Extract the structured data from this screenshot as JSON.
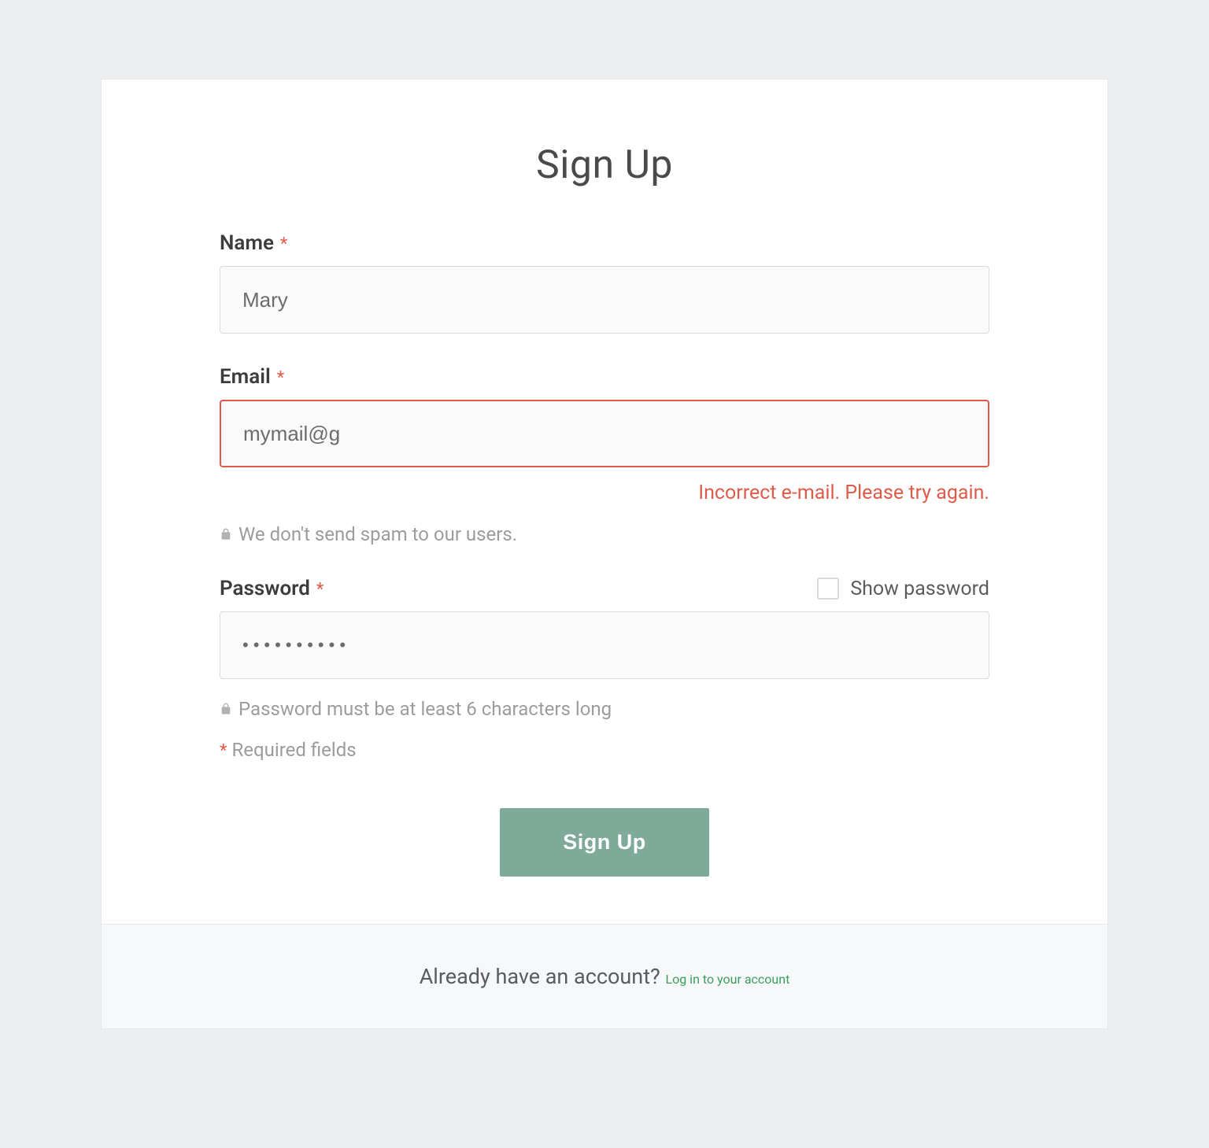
{
  "title": "Sign Up",
  "fields": {
    "name": {
      "label": "Name",
      "value": "Mary",
      "required": true
    },
    "email": {
      "label": "Email",
      "value": "mymail@g",
      "required": true,
      "error": "Incorrect e-mail. Please try again.",
      "helper": "We don't send spam to our users."
    },
    "password": {
      "label": "Password",
      "value": "••••••••••",
      "required": true,
      "helper": "Password must be at least 6 characters long",
      "showPasswordLabel": "Show password"
    }
  },
  "requiredNote": "Required fields",
  "submitLabel": "Sign Up",
  "footer": {
    "text": "Already have an account? ",
    "linkText": "Log in to your account"
  },
  "asterisk": "*"
}
